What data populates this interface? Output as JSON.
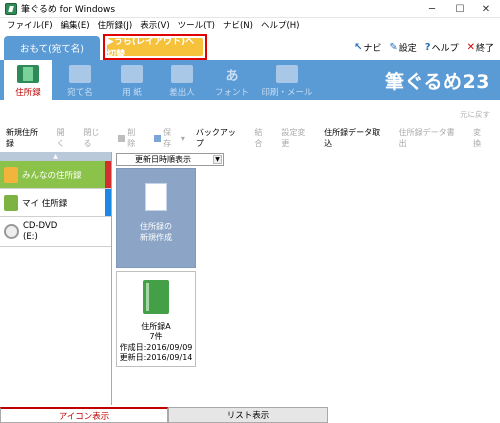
{
  "window": {
    "title": "筆ぐるめ for Windows"
  },
  "menu": [
    "ファイル(F)",
    "編集(E)",
    "住所録(J)",
    "表示(V)",
    "ツール(T)",
    "ナビ(N)",
    "ヘルプ(H)"
  ],
  "tabs": {
    "address_label": "おもて(宛て名)",
    "layout_label": "▶うら(レイアウト)へ切替"
  },
  "toplinks": {
    "navi": "ナビ",
    "settings": "設定",
    "help": "ヘルプ",
    "exit": "終了"
  },
  "ribbon": {
    "buttons": [
      "住所録",
      "宛て名",
      "用 紙",
      "差出人",
      "フォント",
      "印刷・メール"
    ],
    "brand": "筆ぐるめ23"
  },
  "undo_label": "元に戻す",
  "toolbar": {
    "items": [
      "新規住所録",
      "開く",
      "閉じる",
      "削除",
      "保存",
      "バックアップ",
      "結合",
      "設定変更",
      "住所録データ取込",
      "住所録データ書出",
      "変換"
    ]
  },
  "sidebar": {
    "items": [
      "みんなの住所録",
      "マイ 住所録"
    ],
    "cd_line1": "CD-DVD",
    "cd_line2": "(E:)"
  },
  "sort": {
    "selected": "更新日時順表示"
  },
  "cards": {
    "new_line1": "住所録の",
    "new_line2": "新規作成",
    "a_name": "住所録A",
    "a_count": "7件",
    "a_created": "作成日:2016/09/09",
    "a_updated": "更新日:2016/09/14"
  },
  "bottom_tabs": {
    "icon_view": "アイコン表示",
    "list_view": "リスト表示"
  },
  "colors": {
    "ribbon_blue": "#5b9bd5",
    "layout_tab_orange": "#f6c23c",
    "highlight_red": "#e00000",
    "active_green": "#8bc24a"
  }
}
